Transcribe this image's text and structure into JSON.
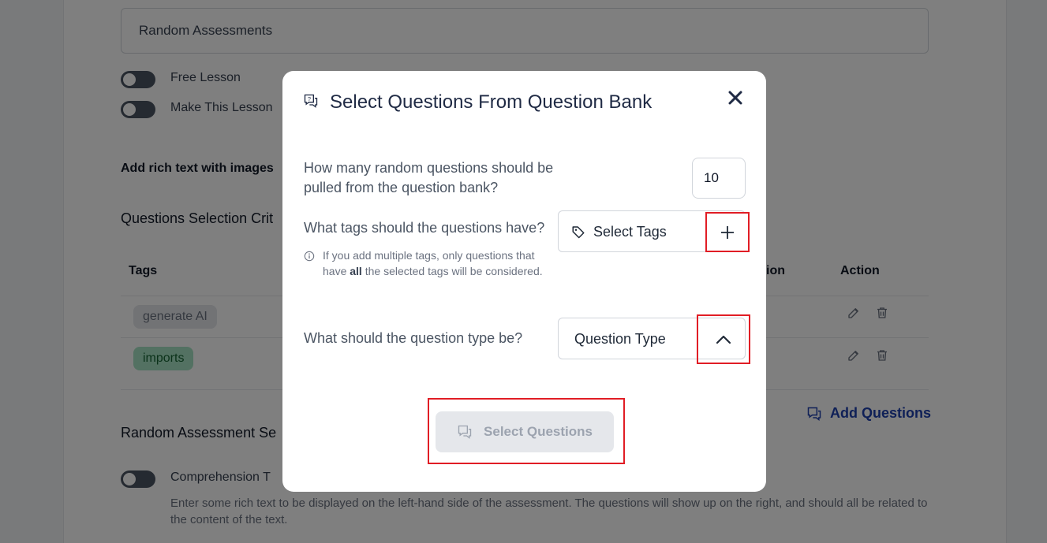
{
  "background": {
    "lesson_title_value": "Random Assessments",
    "toggles": {
      "free_lesson": "Free Lesson",
      "make_this_lesson": "Make This Lesson"
    },
    "rich_text_label": "Add rich text with images",
    "questions_selection_heading": "Questions Selection Crit",
    "table": {
      "headers": {
        "tags": "Tags",
        "question_type_partial": "ion",
        "action": "Action"
      },
      "rows": [
        {
          "tag": "generate AI",
          "tag_style": "gray"
        },
        {
          "tag": "imports",
          "tag_style": "green"
        }
      ]
    },
    "add_questions_label": "Add Questions",
    "random_assessment_heading": "Random Assessment Se",
    "comprehension_label": "Comprehension T",
    "comprehension_help": "Enter some rich text to be displayed on the left-hand side of the assessment. The questions will show up on the right, and should all be related to the content of the text."
  },
  "modal": {
    "title": "Select Questions From Question Bank",
    "count_question": "How many random questions should be pulled from the question bank?",
    "count_value": "10",
    "tags_question": "What tags should the questions have?",
    "tags_placeholder": "Select Tags",
    "tags_note_prefix": "If you add multiple tags, only questions that have ",
    "tags_note_bold": "all",
    "tags_note_suffix": " the selected tags will be considered.",
    "type_question": "What should the question type be?",
    "type_placeholder": "Question Type",
    "select_button_label": "Select Questions"
  },
  "colors": {
    "highlight": "#e11d25",
    "title": "#1f2a44",
    "link": "#1e40af",
    "tag_green_bg": "#a7e3c4",
    "tag_gray_bg": "#e5e7eb"
  }
}
